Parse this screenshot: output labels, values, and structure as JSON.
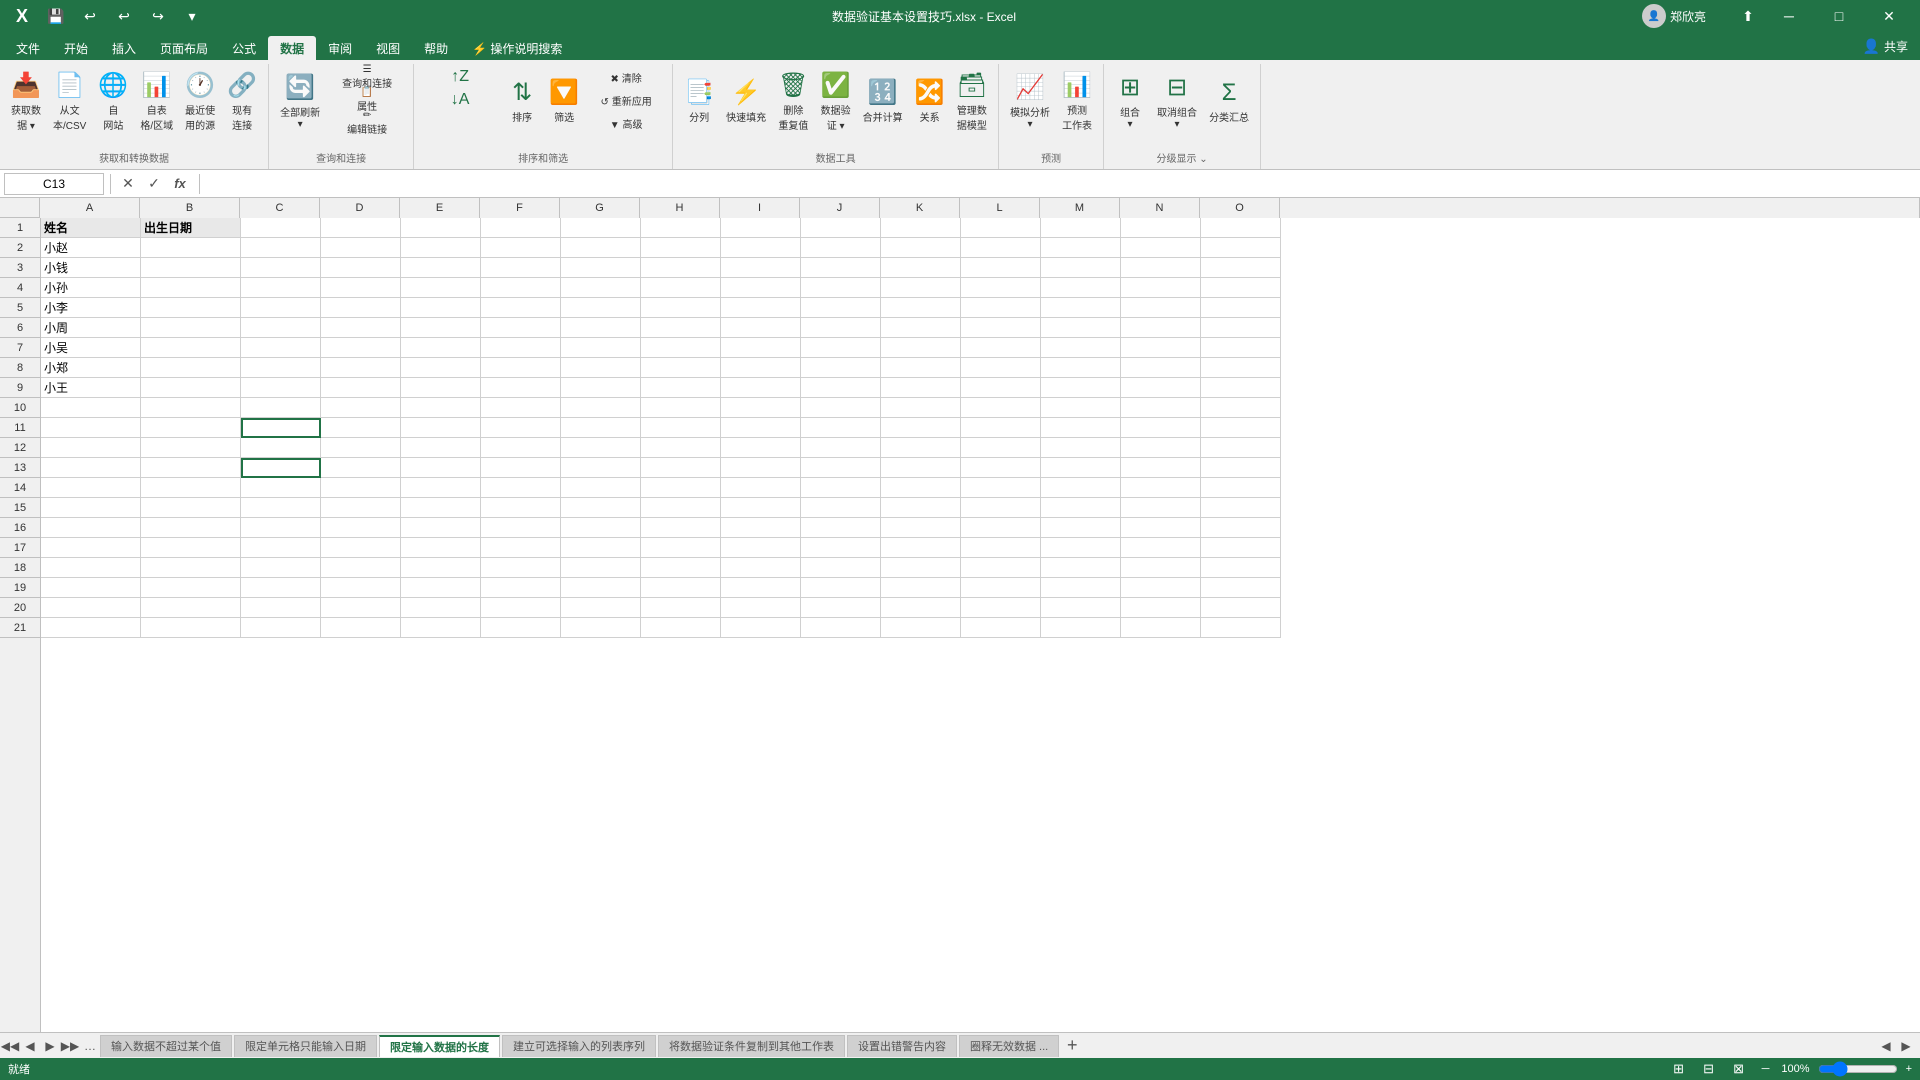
{
  "titlebar": {
    "title": "数据验证基本设置技巧.xlsx - Excel",
    "user": "郑欣亮",
    "minimize": "─",
    "maximize": "□",
    "close": "✕"
  },
  "quickaccess": {
    "save": "💾",
    "undo": "↩",
    "redo": "↪"
  },
  "ribbon_tabs": [
    {
      "label": "文件",
      "active": false
    },
    {
      "label": "开始",
      "active": false
    },
    {
      "label": "插入",
      "active": false
    },
    {
      "label": "页面布局",
      "active": false
    },
    {
      "label": "公式",
      "active": false
    },
    {
      "label": "数据",
      "active": true
    },
    {
      "label": "审阅",
      "active": false
    },
    {
      "label": "视图",
      "active": false
    },
    {
      "label": "帮助",
      "active": false
    },
    {
      "label": "⚡ 操作说明搜索",
      "active": false
    }
  ],
  "ribbon_groups": {
    "get_data": {
      "label": "获取和转换数据",
      "buttons": [
        {
          "id": "get-data",
          "label": "获取数据\n据",
          "icon": "📥"
        },
        {
          "id": "from-text-csv",
          "label": "从文\n本/CSV",
          "icon": "📄"
        },
        {
          "id": "from-web",
          "label": "自\n网站",
          "icon": "🌐"
        },
        {
          "id": "from-table",
          "label": "自表\n格/区域",
          "icon": "📊"
        },
        {
          "id": "recent-sources",
          "label": "最近使\n用的源",
          "icon": "🕐"
        },
        {
          "id": "existing-connections",
          "label": "现有\n连接",
          "icon": "🔗"
        }
      ]
    },
    "query_connect": {
      "label": "查询和连接",
      "buttons": [
        {
          "id": "refresh-all",
          "label": "全部刷新",
          "icon": "🔄"
        },
        {
          "id": "query-connect",
          "label": "查询和连接",
          "icon": "☰"
        },
        {
          "id": "properties",
          "label": "属性",
          "icon": "📋"
        },
        {
          "id": "edit-links",
          "label": "编辑链接",
          "icon": "🔗"
        }
      ]
    },
    "sort_filter": {
      "label": "排序和筛选",
      "buttons": [
        {
          "id": "sort-az",
          "label": "↑Z",
          "icon": ""
        },
        {
          "id": "sort-za",
          "label": "↓A",
          "icon": ""
        },
        {
          "id": "sort",
          "label": "排序",
          "icon": ""
        },
        {
          "id": "filter",
          "label": "筛选",
          "icon": ""
        },
        {
          "id": "clear",
          "label": "清除",
          "icon": ""
        },
        {
          "id": "reapply",
          "label": "重新应用",
          "icon": ""
        },
        {
          "id": "advanced",
          "label": "高级",
          "icon": ""
        }
      ]
    },
    "data_tools": {
      "label": "数据工具",
      "buttons": [
        {
          "id": "text-to-columns",
          "label": "分列",
          "icon": "📑"
        },
        {
          "id": "flash-fill",
          "label": "快速填充",
          "icon": "⚡"
        },
        {
          "id": "remove-duplicates",
          "label": "删除\n重复值",
          "icon": "🗑"
        },
        {
          "id": "data-validation",
          "label": "数据验\n证",
          "icon": "✅"
        },
        {
          "id": "consolidate",
          "label": "合并计算",
          "icon": "🔢"
        },
        {
          "id": "relationships",
          "label": "关系",
          "icon": "🔀"
        },
        {
          "id": "manage-data-model",
          "label": "管理数\n据模型",
          "icon": "🗃"
        }
      ]
    },
    "forecast": {
      "label": "预测",
      "buttons": [
        {
          "id": "what-if",
          "label": "模拟分析",
          "icon": "📈"
        },
        {
          "id": "forecast-sheet",
          "label": "预测\n工作表",
          "icon": "📊"
        }
      ]
    },
    "outline": {
      "label": "分级显示",
      "buttons": [
        {
          "id": "group",
          "label": "组合",
          "icon": ""
        },
        {
          "id": "ungroup",
          "label": "取消组合",
          "icon": ""
        },
        {
          "id": "subtotal",
          "label": "分类汇总",
          "icon": ""
        }
      ]
    }
  },
  "formula_bar": {
    "cell_reference": "C13",
    "formula": "",
    "cancel_label": "✕",
    "confirm_label": "✓",
    "insert_function_label": "fx"
  },
  "columns": [
    "A",
    "B",
    "C",
    "D",
    "E",
    "F",
    "G",
    "H",
    "I",
    "J",
    "K",
    "L",
    "M",
    "N",
    "O"
  ],
  "column_widths": {
    "A": 100,
    "B": 100,
    "default": 80
  },
  "rows": 21,
  "cells": {
    "A1": "姓名",
    "B1": "出生日期",
    "A2": "小赵",
    "A3": "小钱",
    "A4": "小孙",
    "A5": "小李",
    "A6": "小周",
    "A7": "小吴",
    "A8": "小郑",
    "A9": "小王"
  },
  "selected_cell": "C13",
  "sheet_tabs": [
    {
      "label": "输入数据不超过某个值",
      "active": false
    },
    {
      "label": "限定单元格只能输入日期",
      "active": false
    },
    {
      "label": "限定输入数据的长度",
      "active": true
    },
    {
      "label": "建立可选择输入的列表序列",
      "active": false
    },
    {
      "label": "将数据验证条件复制到其他工作表",
      "active": false
    },
    {
      "label": "设置出错警告内容",
      "active": false
    },
    {
      "label": "圈释无效数据 ...",
      "active": false
    }
  ],
  "status_bar": {
    "status": "就绪",
    "zoom": "100%"
  },
  "share_label": "共享"
}
